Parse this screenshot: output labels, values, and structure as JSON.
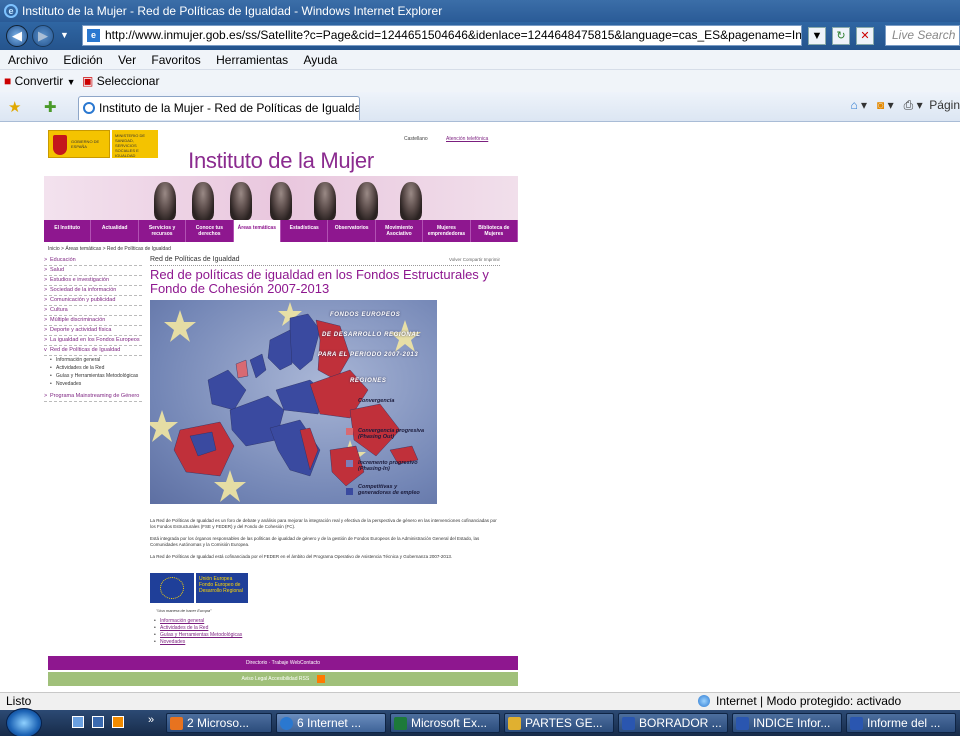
{
  "window": {
    "title": "Instituto de la Mujer - Red de Políticas de Igualdad - Windows Internet Explorer"
  },
  "address": {
    "url": "http://www.inmujer.gob.es/ss/Satellite?c=Page&cid=1244651504646&idenlace=1244648475815&language=cas_ES&pagename=InstitutoM",
    "search_placeholder": "Live Search"
  },
  "menu": [
    "Archivo",
    "Edición",
    "Ver",
    "Favoritos",
    "Herramientas",
    "Ayuda"
  ],
  "cmdbar": {
    "convert": "Convertir",
    "select": "Seleccionar"
  },
  "tab": {
    "label": "Instituto de la Mujer - Red de Políticas de Igualdad",
    "page_tools": "Págin"
  },
  "site": {
    "gov_text": "GOBIERNO DE ESPAÑA",
    "ministry_text": "MINISTERIO DE SANIDAD, SERVICIOS SOCIALES E IGUALDAD",
    "title": "Instituto de la Mujer",
    "lang": "Castellano",
    "phone": "Atención telefónica",
    "nav": [
      "El Instituto",
      "Actualidad",
      "Servicios y recursos",
      "Conoce tus derechos",
      "Áreas temáticas",
      "Estadísticas",
      "Observatorios",
      "Movimiento Asociativo",
      "Mujeres emprendedoras",
      "Biblioteca de Mujeres"
    ],
    "breadcrumb": "Inicio > Áreas temáticas > Red de Políticas de Igualdad",
    "sidebar": [
      "Educación",
      "Salud",
      "Estudios e investigación",
      "Sociedad de la información",
      "Comunicación y publicidad",
      "Cultura",
      "Múltiple discriminación",
      "Deporte y actividad física",
      "La igualdad en los Fondos Europeos",
      "Red de Políticas de Igualdad"
    ],
    "sidebar_sub": [
      "Información general",
      "Actividades de la Red",
      "Guías y Herramientas Metodológicas",
      "Novedades"
    ],
    "sidebar_last": "Programa Mainstreaming de Género",
    "section_label": "Red de Políticas de Igualdad",
    "tools": "Volver   Compartir   Imprimir",
    "heading": "Red de políticas de igualdad en los Fondos Estructurales y Fondo de Cohesión 2007-2013",
    "map": {
      "t1": "FONDOS EUROPEOS",
      "t2": "DE DESARROLLO REGIONAL",
      "t3": "PARA EL PERIODO 2007-2013",
      "regions": "REGIONES",
      "legend": [
        "Convergencia",
        "Convergencia progresiva (Phasing Out)",
        "Incremento progresivo (Phasing-In)",
        "Competitivas y generadoras de empleo"
      ],
      "colors": [
        "#c0303a",
        "#d86a72",
        "#7d7fb8",
        "#3a4aa0"
      ]
    },
    "p1": "La Red de Políticas de Igualdad es un foro de debate y análisis para mejorar la integración real y efectiva de la perspectiva de género en las intervenciones cofinanciadas por los Fondos Estructurales (FSE y FEDER) y del Fondo de Cohesión (FC).",
    "p2": "Está integrada por los órganos responsables de las políticas de igualdad de género y de la gestión de Fondos Europeos de la Administración General del Estado, las Comunidades Autónomas y la Comisión Europea.",
    "p3": "La Red de Políticas de Igualdad está cofinanciada por el FEDER en el ámbito del Programa Operativo de Asistencia Técnica y Gobernanza 2007-2013.",
    "eu_title": "Unión Europea",
    "eu_sub": "Fondo Europeo de Desarrollo Regional",
    "eu_caption": "\"Una manera de hacer Europa\"",
    "links": [
      "Información general",
      "Actividades de la Red",
      "Guías y Herramientas Metodológicas",
      "Novedades"
    ],
    "footer1": "Directorio · Trabaje WebContacto",
    "footer2": "Aviso Legal Accesibilidad RSS"
  },
  "status": {
    "left": "Listo",
    "zone": "Internet | Modo protegido: activado"
  },
  "taskbar": [
    "2 Microso...",
    "6 Internet ...",
    "Microsoft Ex...",
    "PARTES GE...",
    "BORRADOR ...",
    "INDICE Infor...",
    "Informe del ..."
  ]
}
